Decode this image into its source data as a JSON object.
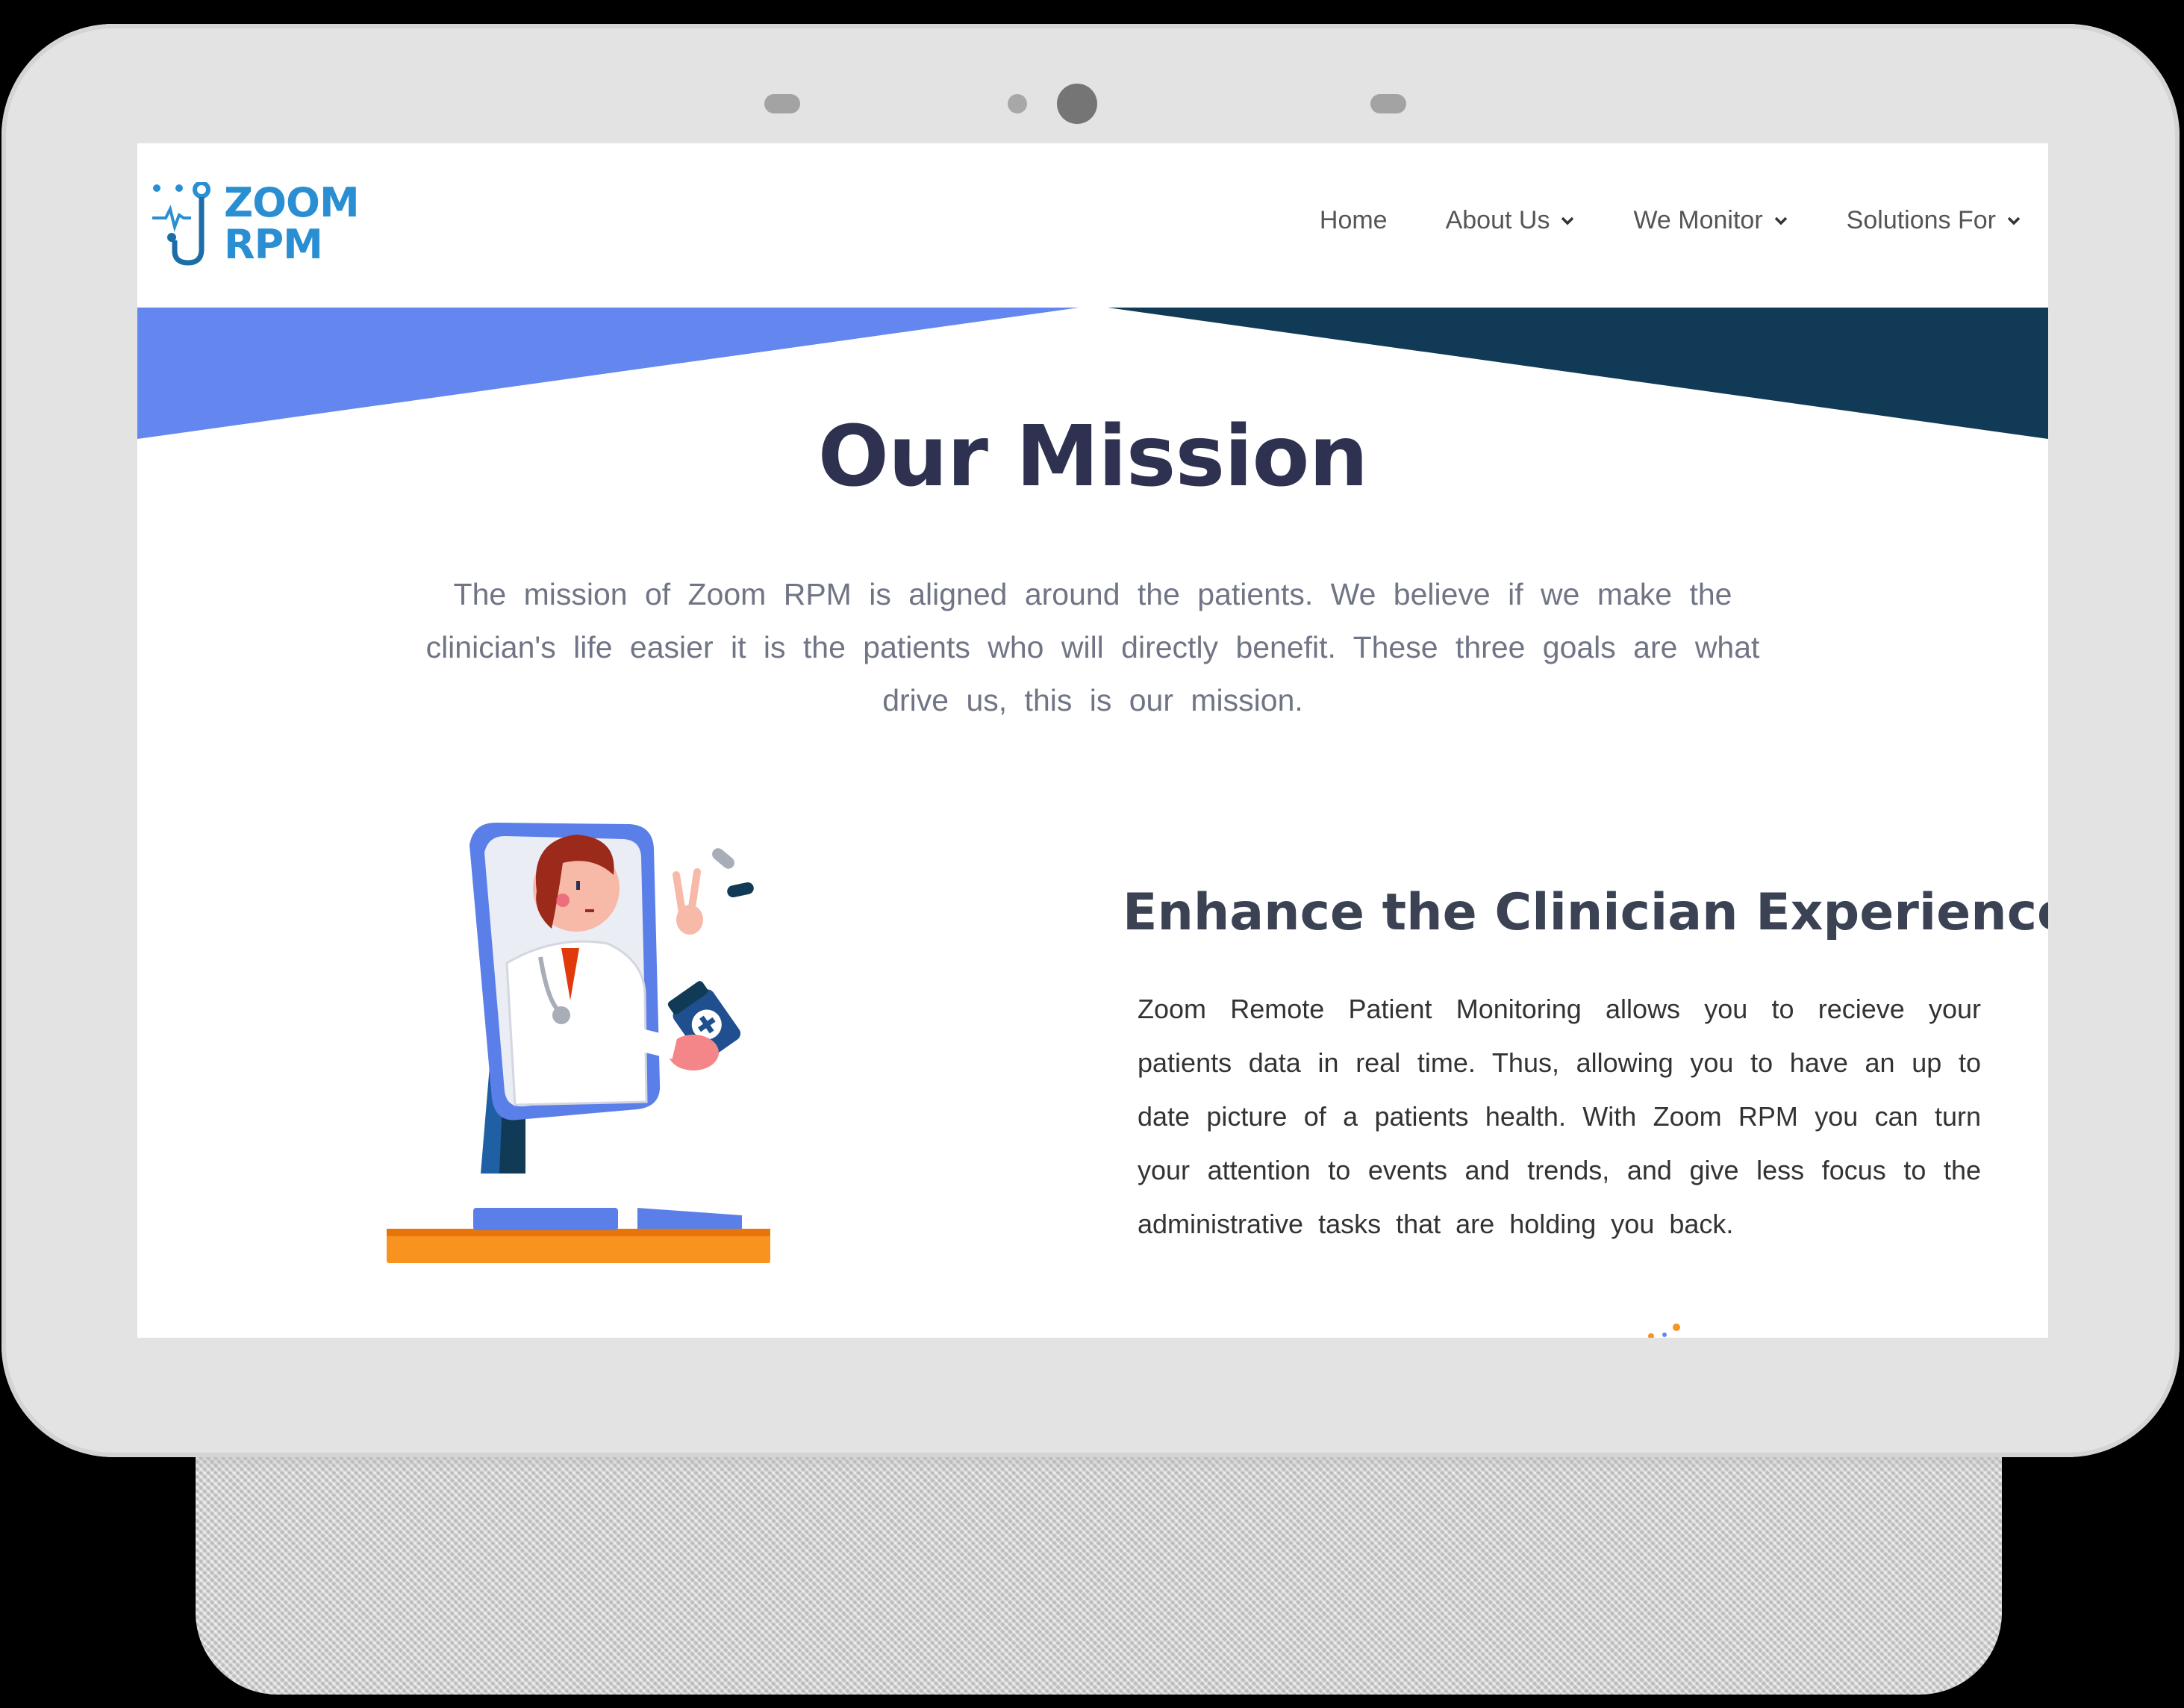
{
  "site": {
    "logo_line1": "ZOOM",
    "logo_line2": "RPM",
    "brand_color": "#2a8fd2"
  },
  "nav": {
    "items": [
      {
        "label": "Home",
        "has_dropdown": false
      },
      {
        "label": "About Us",
        "has_dropdown": true
      },
      {
        "label": "We Monitor",
        "has_dropdown": true
      },
      {
        "label": "Solutions For",
        "has_dropdown": true
      }
    ]
  },
  "hero": {
    "title": "Our Mission",
    "text": "The mission of Zoom RPM is aligned around the patients. We believe if we make the clinician's life easier it is the patients who will directly benefit. These three goals are what drive us, this is our mission.",
    "band_left_color": "#6486ef",
    "band_right_color": "#103a55"
  },
  "feature": {
    "title": "Enhance the Clinician Experience",
    "text": "Zoom Remote Patient Monitoring allows you to recieve your patients data in real time. Thus, allowing you to have an up to date picture of a patients health. With Zoom RPM you can turn your attention to events and trends, and give less focus to the administrative tasks that are holding you back.",
    "illustration_icon": "doctor-with-medicine-illustration"
  },
  "colors": {
    "title": "#2e3250",
    "body_text": "#707585",
    "accent_orange": "#f7931e"
  }
}
